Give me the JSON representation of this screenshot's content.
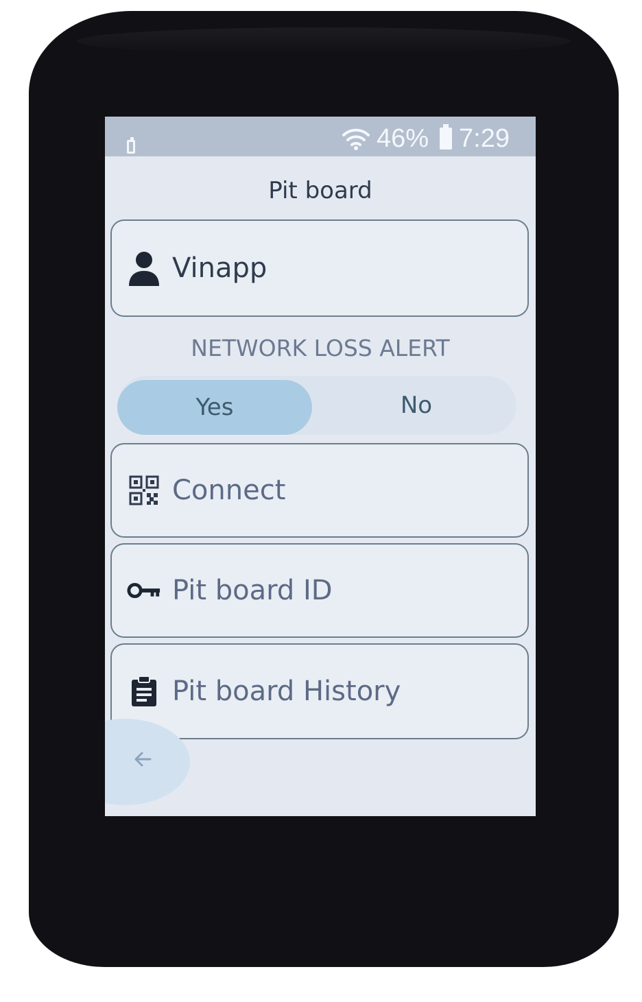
{
  "status_bar": {
    "wifi_icon": "wifi-icon",
    "battery_percent": "46%",
    "time": "7:29"
  },
  "app": {
    "title": "Pit board"
  },
  "user": {
    "name": "Vinapp",
    "icon": "person-icon"
  },
  "network_loss_alert": {
    "title": "NETWORK LOSS ALERT",
    "options": [
      "Yes",
      "No"
    ],
    "selected": "Yes"
  },
  "menu": {
    "connect": {
      "label": "Connect",
      "icon": "qr-code-icon"
    },
    "pit_board_id": {
      "label": "Pit board ID",
      "icon": "key-icon"
    },
    "pit_board_history": {
      "label": "Pit board History",
      "icon": "clipboard-icon"
    }
  },
  "navigation": {
    "back_icon": "back-arrow-icon"
  },
  "colors": {
    "screen_background": "#e4e9f1",
    "status_bar": "#b3bfce",
    "toggle_selected": "#a9cbe3",
    "card_border": "#6b7d8c",
    "text_dark": "#2f3b4d",
    "text_muted": "#5d6a86"
  }
}
